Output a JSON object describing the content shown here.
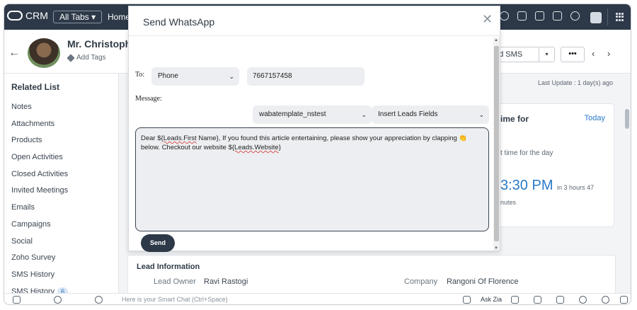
{
  "topnav": {
    "app_name": "CRM",
    "all_tabs": "All Tabs ▾",
    "home": "Home"
  },
  "record": {
    "name": "Mr. Christophe",
    "add_tags": "Add Tags",
    "send_sms": "nd SMS",
    "more": "•••"
  },
  "related": {
    "title": "Related List",
    "items": [
      "Notes",
      "Attachments",
      "Products",
      "Open Activities",
      "Closed Activities",
      "Invited Meetings",
      "Emails",
      "Campaigns",
      "Social",
      "Zoho Survey",
      "SMS History"
    ],
    "last_item": "SMS History",
    "last_badge": "6"
  },
  "right": {
    "last_update": "Last Update : 1 day(s) ago",
    "card_head": "ime for",
    "card_link": "Today",
    "card_sub": "t time for the day",
    "card_time": "3:30 PM",
    "card_time_sub": "in 3 hours 47",
    "card_min": "nutes"
  },
  "lead": {
    "title": "Lead Information",
    "owner_label": "Lead Owner",
    "owner_value": "Ravi Rastogi",
    "company_label": "Company",
    "company_value": "Rangoni Of Florence"
  },
  "bottom": {
    "smart_chat": "Here is your Smart Chat (Ctrl+Space)",
    "ask_zia": "Ask Zia"
  },
  "modal": {
    "title": "Send WhatsApp",
    "to_label": "To:",
    "to_type": "Phone",
    "phone_value": "7667157458",
    "message_label": "Message:",
    "template": "wabatemplate_nstest",
    "insert_field": "Insert Leads Fields",
    "msg_part1": "Dear $",
    "msg_field1": "{Leads.First",
    "msg_part2": " Name}, If you found this article entertaining, please show your appreciation by clapping ",
    "msg_emoji": "👏",
    "msg_part3": " below. Checkout our website $",
    "msg_field2": "{Leads.Website",
    "msg_part4": "}",
    "send": "Send"
  }
}
